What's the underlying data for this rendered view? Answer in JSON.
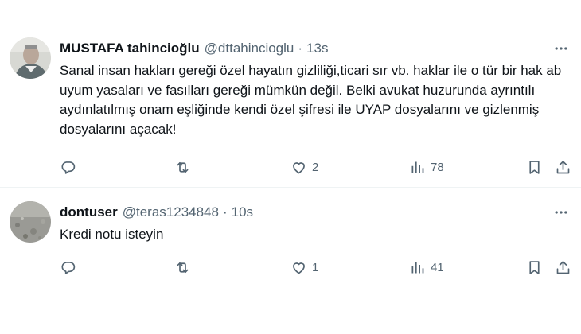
{
  "tweets": [
    {
      "author_name": "MUSTAFA tahincioğlu",
      "handle": "@dttahincioglu",
      "separator": "·",
      "time": "13s",
      "text": "Sanal insan hakları gereği özel hayatın gizliliği,ticari sır vb. haklar ile o tür bir hak ab uyum yasaları ve fasılları gereği mümkün değil. Belki avukat huzurunda ayrıntılı aydınlatılmış onam eşliğinde kendi özel şifresi ile UYAP dosyalarını ve gizlenmiş dosyalarını açacak!",
      "likes": "2",
      "views": "78"
    },
    {
      "author_name": "dontuser",
      "handle": "@teras1234848",
      "separator": "·",
      "time": "10s",
      "text": "Kredi notu isteyin",
      "likes": "1",
      "views": "41"
    }
  ],
  "icons": {
    "reply": "reply-icon",
    "retweet": "retweet-icon",
    "like": "heart-icon",
    "views": "views-icon",
    "bookmark": "bookmark-icon",
    "share": "share-icon",
    "more": "more-icon"
  },
  "colors": {
    "text": "#0f1419",
    "secondary": "#536471",
    "divider": "#eff3f4"
  }
}
